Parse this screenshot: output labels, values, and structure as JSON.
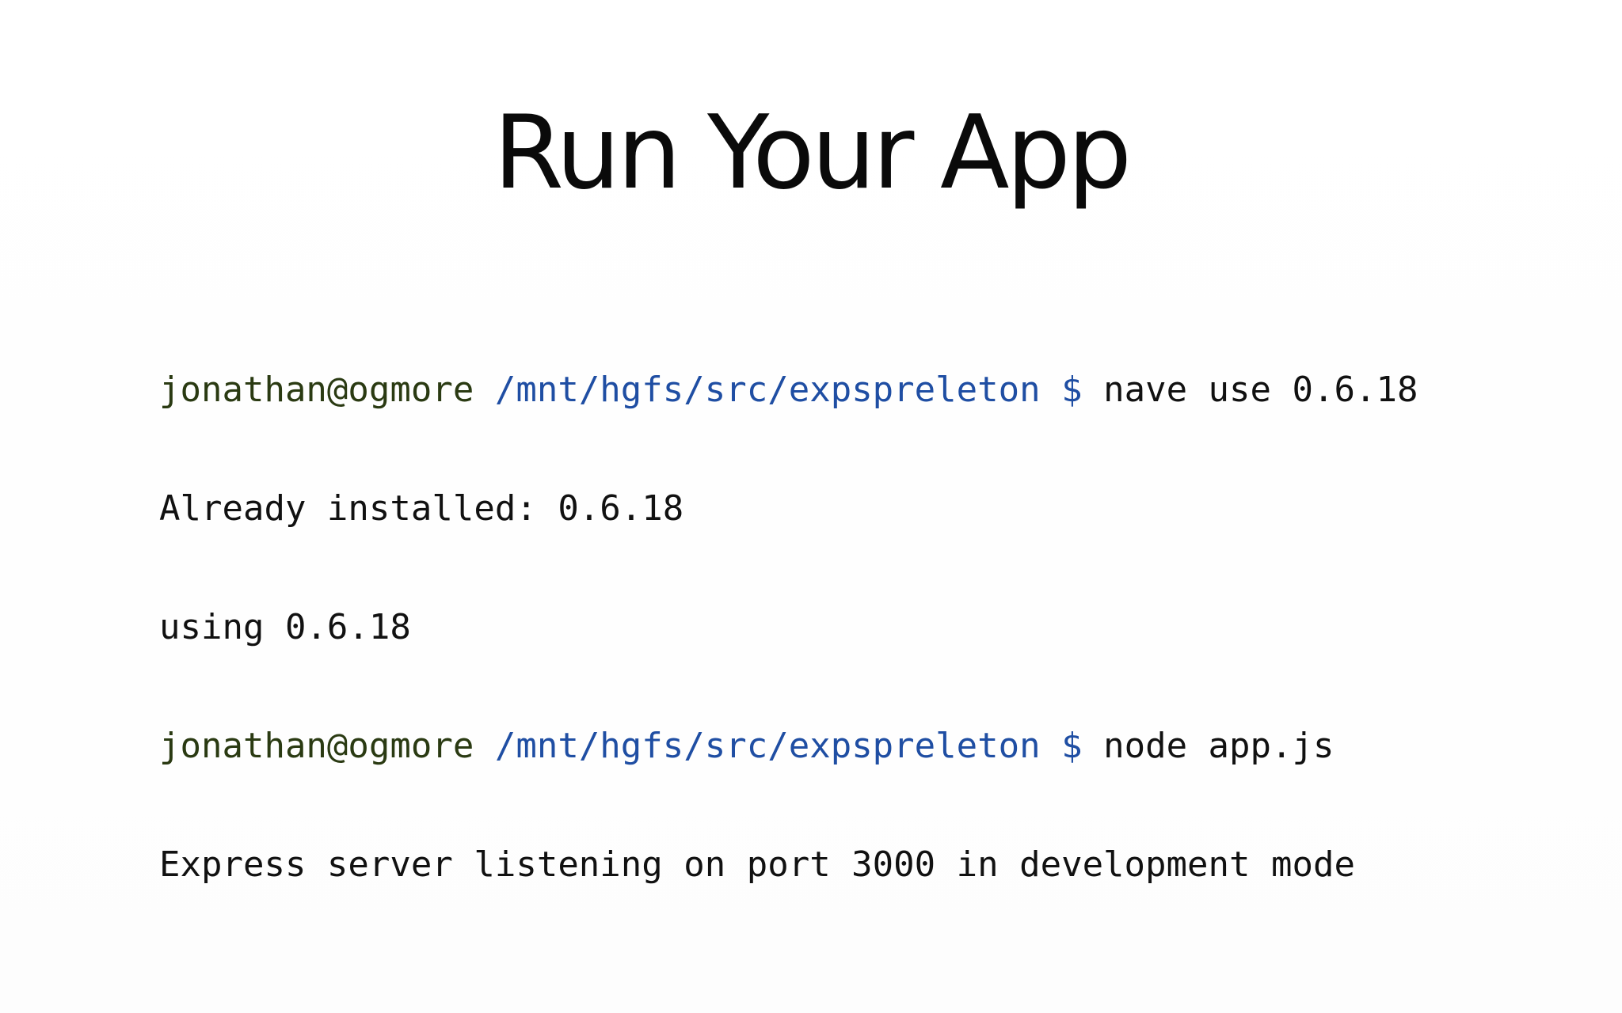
{
  "slide": {
    "title": "Run Your App"
  },
  "terminal": {
    "colors": {
      "user": "#2a3a12",
      "path": "#1f4ea3",
      "text": "#111111"
    },
    "lines": [
      {
        "type": "prompt",
        "user": "jonathan@ogmore",
        "path": "/mnt/hgfs/src/expspreleton",
        "sign": "$",
        "command": "nave use 0.6.18"
      },
      {
        "type": "output",
        "text": "Already installed: 0.6.18"
      },
      {
        "type": "output",
        "text": "using 0.6.18"
      },
      {
        "type": "prompt",
        "user": "jonathan@ogmore",
        "path": "/mnt/hgfs/src/expspreleton",
        "sign": "$",
        "command": "node app.js"
      },
      {
        "type": "output",
        "text": "Express server listening on port 3000 in development mode"
      }
    ]
  }
}
